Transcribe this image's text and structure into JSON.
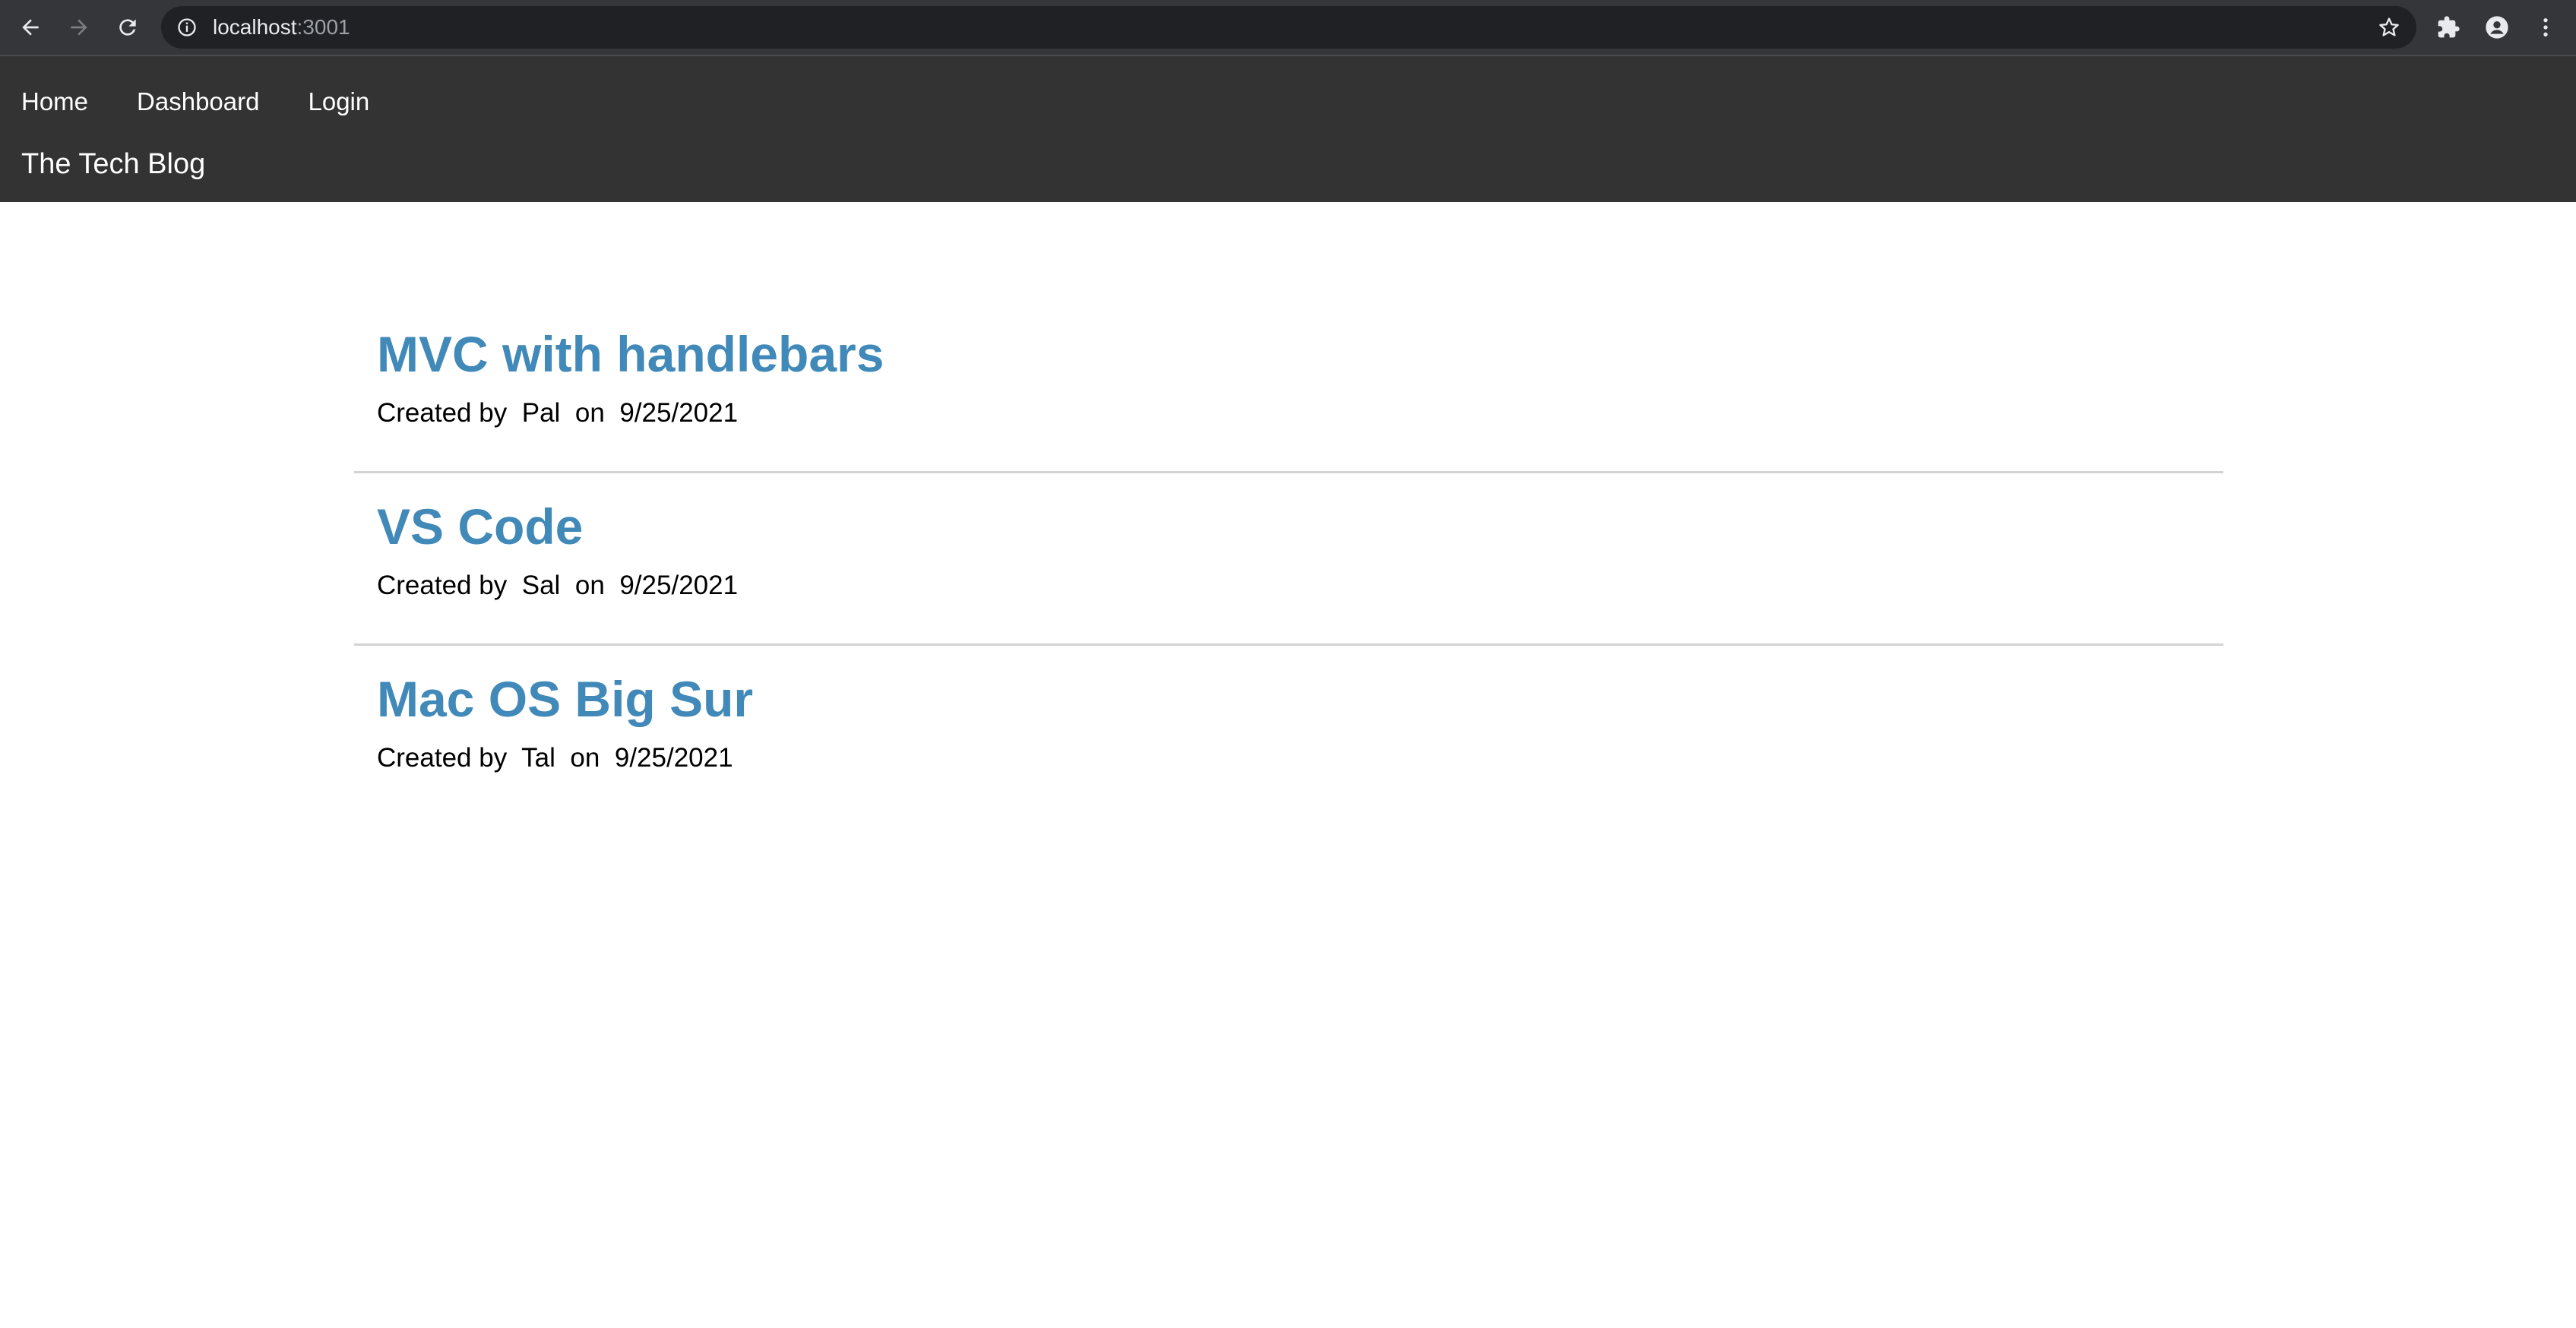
{
  "browser": {
    "url_host": "localhost",
    "url_port": ":3001",
    "icons": [
      "back-arrow-icon",
      "forward-arrow-icon",
      "reload-icon",
      "info-icon",
      "star-icon",
      "extensions-icon",
      "profile-icon",
      "menu-dots-icon"
    ]
  },
  "nav": {
    "home": "Home",
    "dashboard": "Dashboard",
    "login": "Login"
  },
  "site": {
    "title": "The Tech Blog"
  },
  "posts": [
    {
      "title": "MVC with handlebars",
      "created_by_label": "Created by",
      "author": "Pal",
      "on_label": "on",
      "date": "9/25/2021"
    },
    {
      "title": "VS Code",
      "created_by_label": "Created by",
      "author": "Sal",
      "on_label": "on",
      "date": "9/25/2021"
    },
    {
      "title": "Mac OS Big Sur",
      "created_by_label": "Created by",
      "author": "Tal",
      "on_label": "on",
      "date": "9/25/2021"
    }
  ],
  "colors": {
    "chrome_bg": "#35363a",
    "omnibox_bg": "#202124",
    "header_bg": "#333333",
    "post_title": "#4189b8",
    "divider": "#d3d3d3"
  }
}
